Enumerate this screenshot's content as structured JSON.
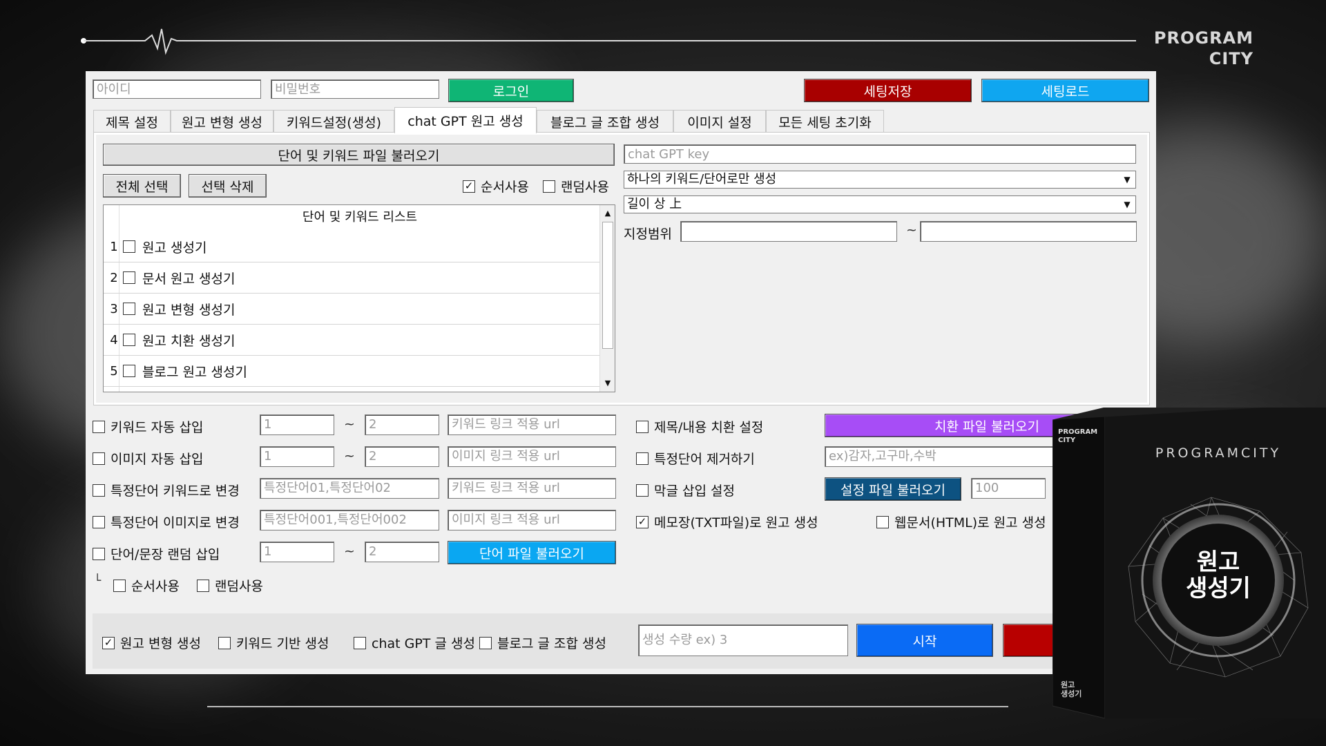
{
  "brand": {
    "line1": "PROGRAM",
    "line2": "CITY"
  },
  "login": {
    "id_placeholder": "아이디",
    "pw_placeholder": "비밀번호",
    "login_label": "로그인",
    "save_label": "세팅저장",
    "load_label": "세팅로드"
  },
  "tabs": [
    {
      "label": "제목 설정"
    },
    {
      "label": "원고 변형 생성"
    },
    {
      "label": "키워드설정(생성)"
    },
    {
      "label": "chat GPT 원고 생성"
    },
    {
      "label": "블로그 글 조합 생성"
    },
    {
      "label": "이미지 설정"
    },
    {
      "label": "모든 세팅 초기화"
    }
  ],
  "panel": {
    "load_file_label": "단어 및 키워드 파일 불러오기",
    "select_all": "전체 선택",
    "delete_selected": "선택 삭제",
    "order_use": "순서사용",
    "random_use": "랜덤사용",
    "list_header": "단어 및 키워드 리스트",
    "list": [
      {
        "num": "1",
        "text": "원고 생성기"
      },
      {
        "num": "2",
        "text": "문서 원고 생성기"
      },
      {
        "num": "3",
        "text": "원고 변형 생성기"
      },
      {
        "num": "4",
        "text": "원고 치환 생성기"
      },
      {
        "num": "5",
        "text": "블로그 원고 생성기"
      }
    ],
    "gpt_key_placeholder": "chat GPT key",
    "mode_select": "하나의 키워드/단어로만 생성",
    "length_select": "길이 상 上",
    "range_label": "지정범위",
    "range_tilde": "~",
    "scroll_up": "▲",
    "scroll_down": "▼",
    "select_arrow": "▼"
  },
  "options": {
    "tilde": "~",
    "kw_auto": "키워드 자동 삽입",
    "kw_from": "1",
    "kw_to": "2",
    "kw_url": "키워드 링크 적용 url",
    "img_auto": "이미지 자동 삽입",
    "img_from": "1",
    "img_to": "2",
    "img_url": "이미지 링크 적용 url",
    "word_to_kw": "특정단어 키워드로 변경",
    "word_to_kw_ph": "특정단어01,특정단어02",
    "kw_url2": "키워드 링크 적용 url",
    "word_to_img": "특정단어 이미지로 변경",
    "word_to_img_ph": "특정단어001,특정단어002",
    "img_url2": "이미지 링크 적용 url",
    "random_insert": "단어/문장 랜덤 삽입",
    "ri_from": "1",
    "ri_to": "2",
    "word_file_btn": "단어 파일 불러오기",
    "sub_prefix": "└",
    "sub_order": "순서사용",
    "sub_random": "랜덤사용",
    "replace_setting": "제목/내용 치환 설정",
    "replace_file_btn": "치환 파일 불러오기",
    "remove_word": "특정단어 제거하기",
    "remove_ph": "ex)감자,고구마,수박",
    "filler_insert": "막글 삽입 설정",
    "setting_file_btn": "설정 파일 불러오기",
    "filler_value": "100",
    "txt_gen": "메모장(TXT파일)로 원고 생성",
    "html_gen": "웹문서(HTML)로 원고 생성"
  },
  "bottom": {
    "transform_gen": "원고 변형 생성",
    "keyword_gen": "키워드 기반 생성",
    "gpt_gen": "chat GPT 글 생성",
    "blog_gen": "블로그 글 조합 생성",
    "count_placeholder": "생성 수량 ex) 3",
    "start_label": "시작"
  },
  "product_box": {
    "side_line1": "PROGRAM",
    "side_line2": "CITY",
    "brand": "PROGRAMCITY",
    "title1": "원고",
    "title2": "생성기",
    "spine1": "원고",
    "spine2": "생성기"
  },
  "colors": {
    "login": "#0fb575",
    "save": "#a80000",
    "load": "#0fa6f0",
    "replace": "#a74df6",
    "setting_file": "#0d5281",
    "word_file": "#0aa7f2",
    "start": "#0a6bf5",
    "stop": "#b80000"
  }
}
